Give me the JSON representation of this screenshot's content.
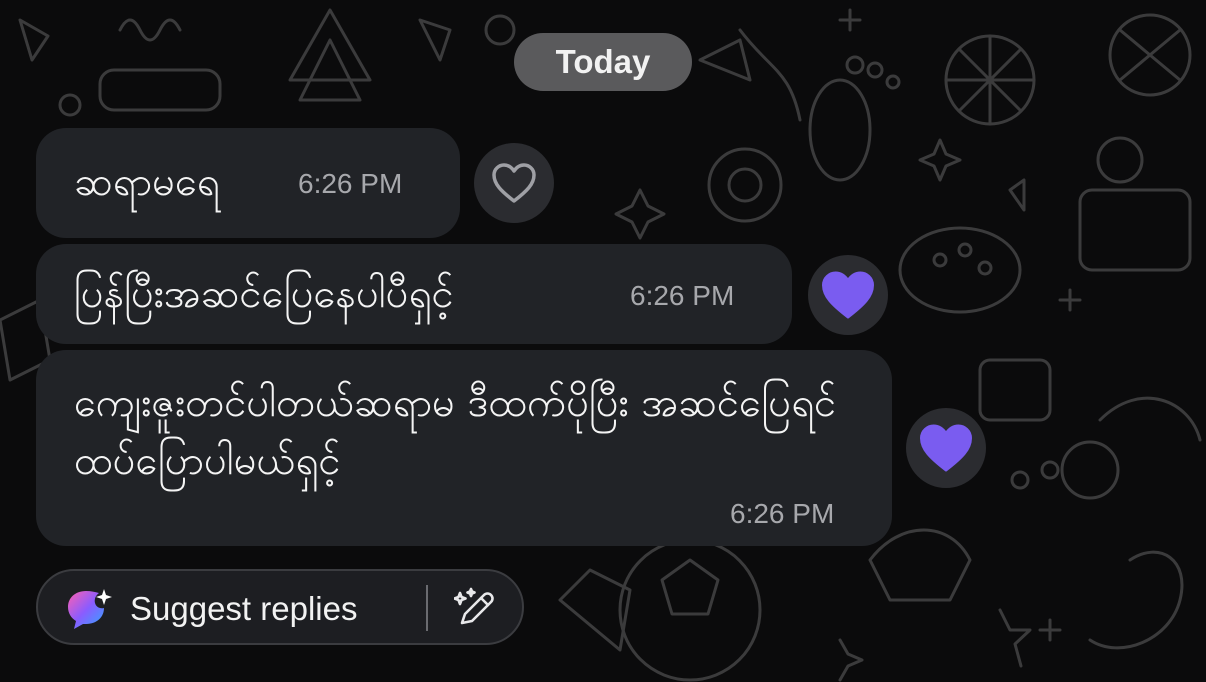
{
  "date_separator": "Today",
  "messages": [
    {
      "text": "ဆရာမရေ",
      "time": "6:26 PM",
      "reaction": "heart-outline"
    },
    {
      "text": "ပြန်ပြီးအဆင်ပြေနေပါပီရှင့်",
      "time": "6:26 PM",
      "reaction": "heart-filled"
    },
    {
      "text": "ကျေးဇူးတင်ပါတယ်ဆရာမ ဒီထက်ပိုပြီး အဆင်ပြေရင်ထပ်ပြောပါမယ်ရှင့်",
      "time": "6:26 PM",
      "reaction": "heart-filled"
    }
  ],
  "suggest": {
    "label": "Suggest replies",
    "ai_icon": "ai-sparkle-chat-icon",
    "edit_icon": "magic-pen-icon"
  },
  "colors": {
    "bubble": "#212327",
    "reaction_filled": "#7a5cf0",
    "background": "#0b0b0c"
  }
}
